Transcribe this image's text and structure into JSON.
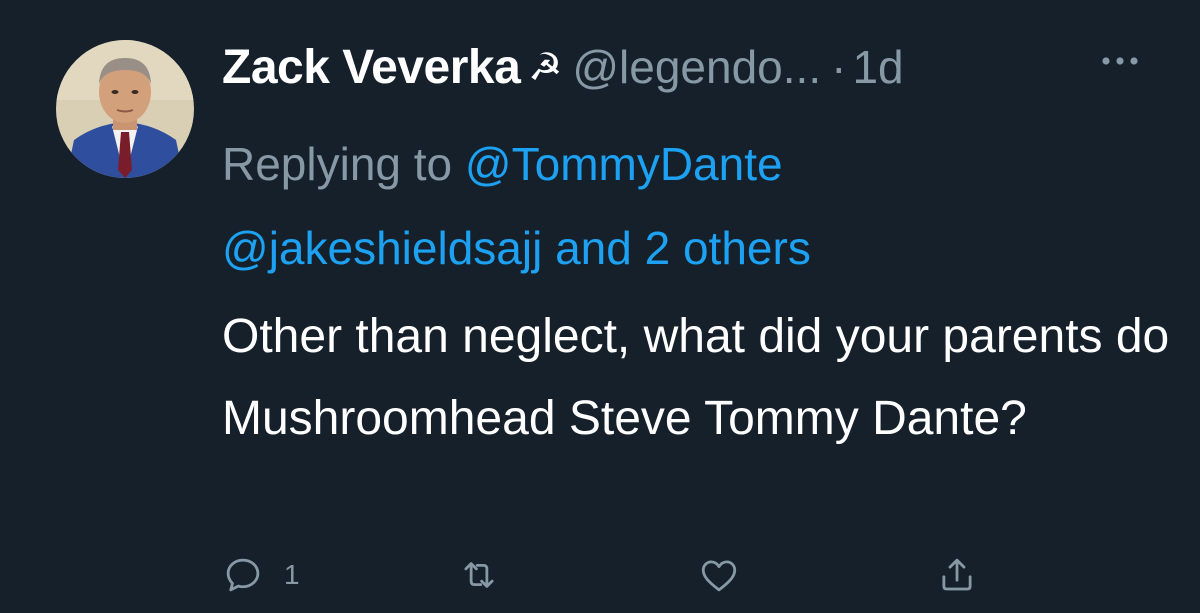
{
  "tweet": {
    "display_name": "Zack Veverka",
    "name_emoji": "☭",
    "handle": "@legendo...",
    "separator": "·",
    "time": "1d",
    "replying_prefix": "Replying to ",
    "replying_mention_1": "@TommyDante",
    "replying_mention_2": "@jakeshieldsajj and 2 others",
    "body": "Other than neglect, what did your parents do Mushroomhead Steve Tommy Dante?",
    "reply_count": "1"
  },
  "icons": {
    "more": "more-icon",
    "reply": "reply-icon",
    "retweet": "retweet-icon",
    "like": "heart-icon",
    "share": "share-icon"
  },
  "colors": {
    "background": "#15202b",
    "secondary_text": "#8899a6",
    "link": "#1da1f2"
  }
}
